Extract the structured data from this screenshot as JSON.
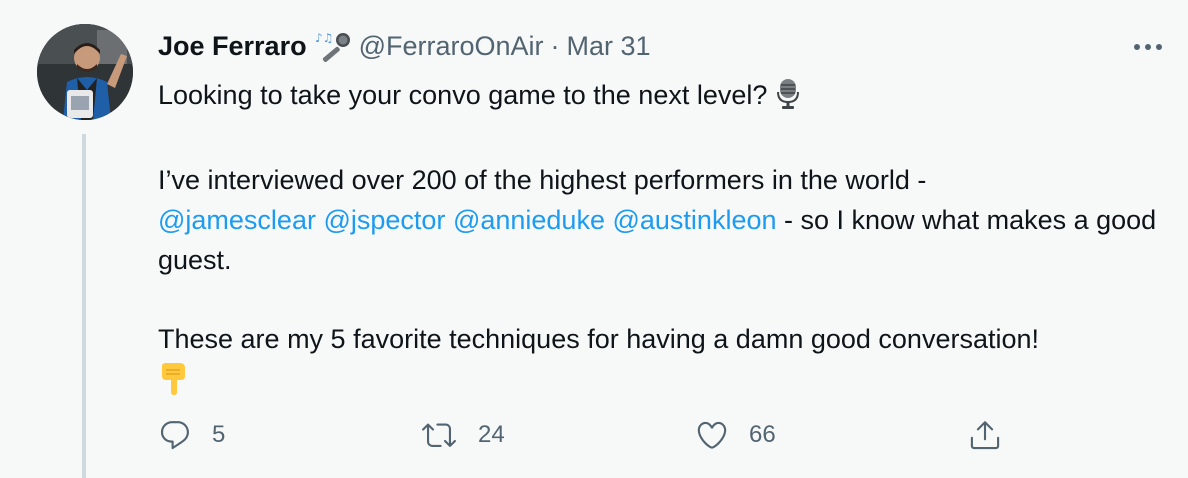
{
  "tweet": {
    "author_name": "Joe Ferraro",
    "name_emoji_icon": "microphone-music-icon",
    "handle": "@FerraroOnAir",
    "separator": "·",
    "date": "Mar 31",
    "more_icon": "ellipsis-icon",
    "line1": "Looking to take your convo game to the next level?",
    "line1_icon": "studio-microphone-icon",
    "para2_start": "I’ve interviewed over 200 of the highest performers in the world -",
    "mentions": [
      "@jamesclear",
      "@jspector",
      "@annieduke",
      "@austinkleon"
    ],
    "para2_end": " - so I know what makes a good guest.",
    "para3": "These are my 5 favorite techniques for having a damn good conversation!",
    "para3_icon": "backhand-index-pointing-down-icon"
  },
  "actions": {
    "reply_count": "5",
    "retweet_count": "24",
    "like_count": "66",
    "reply_icon": "reply-icon",
    "retweet_icon": "retweet-icon",
    "like_icon": "heart-icon",
    "share_icon": "share-icon"
  },
  "colors": {
    "background": "#f7f9f9",
    "text": "#0f1419",
    "secondary": "#536471",
    "link": "#1d9bf0",
    "thread_line": "#cfd9de"
  }
}
